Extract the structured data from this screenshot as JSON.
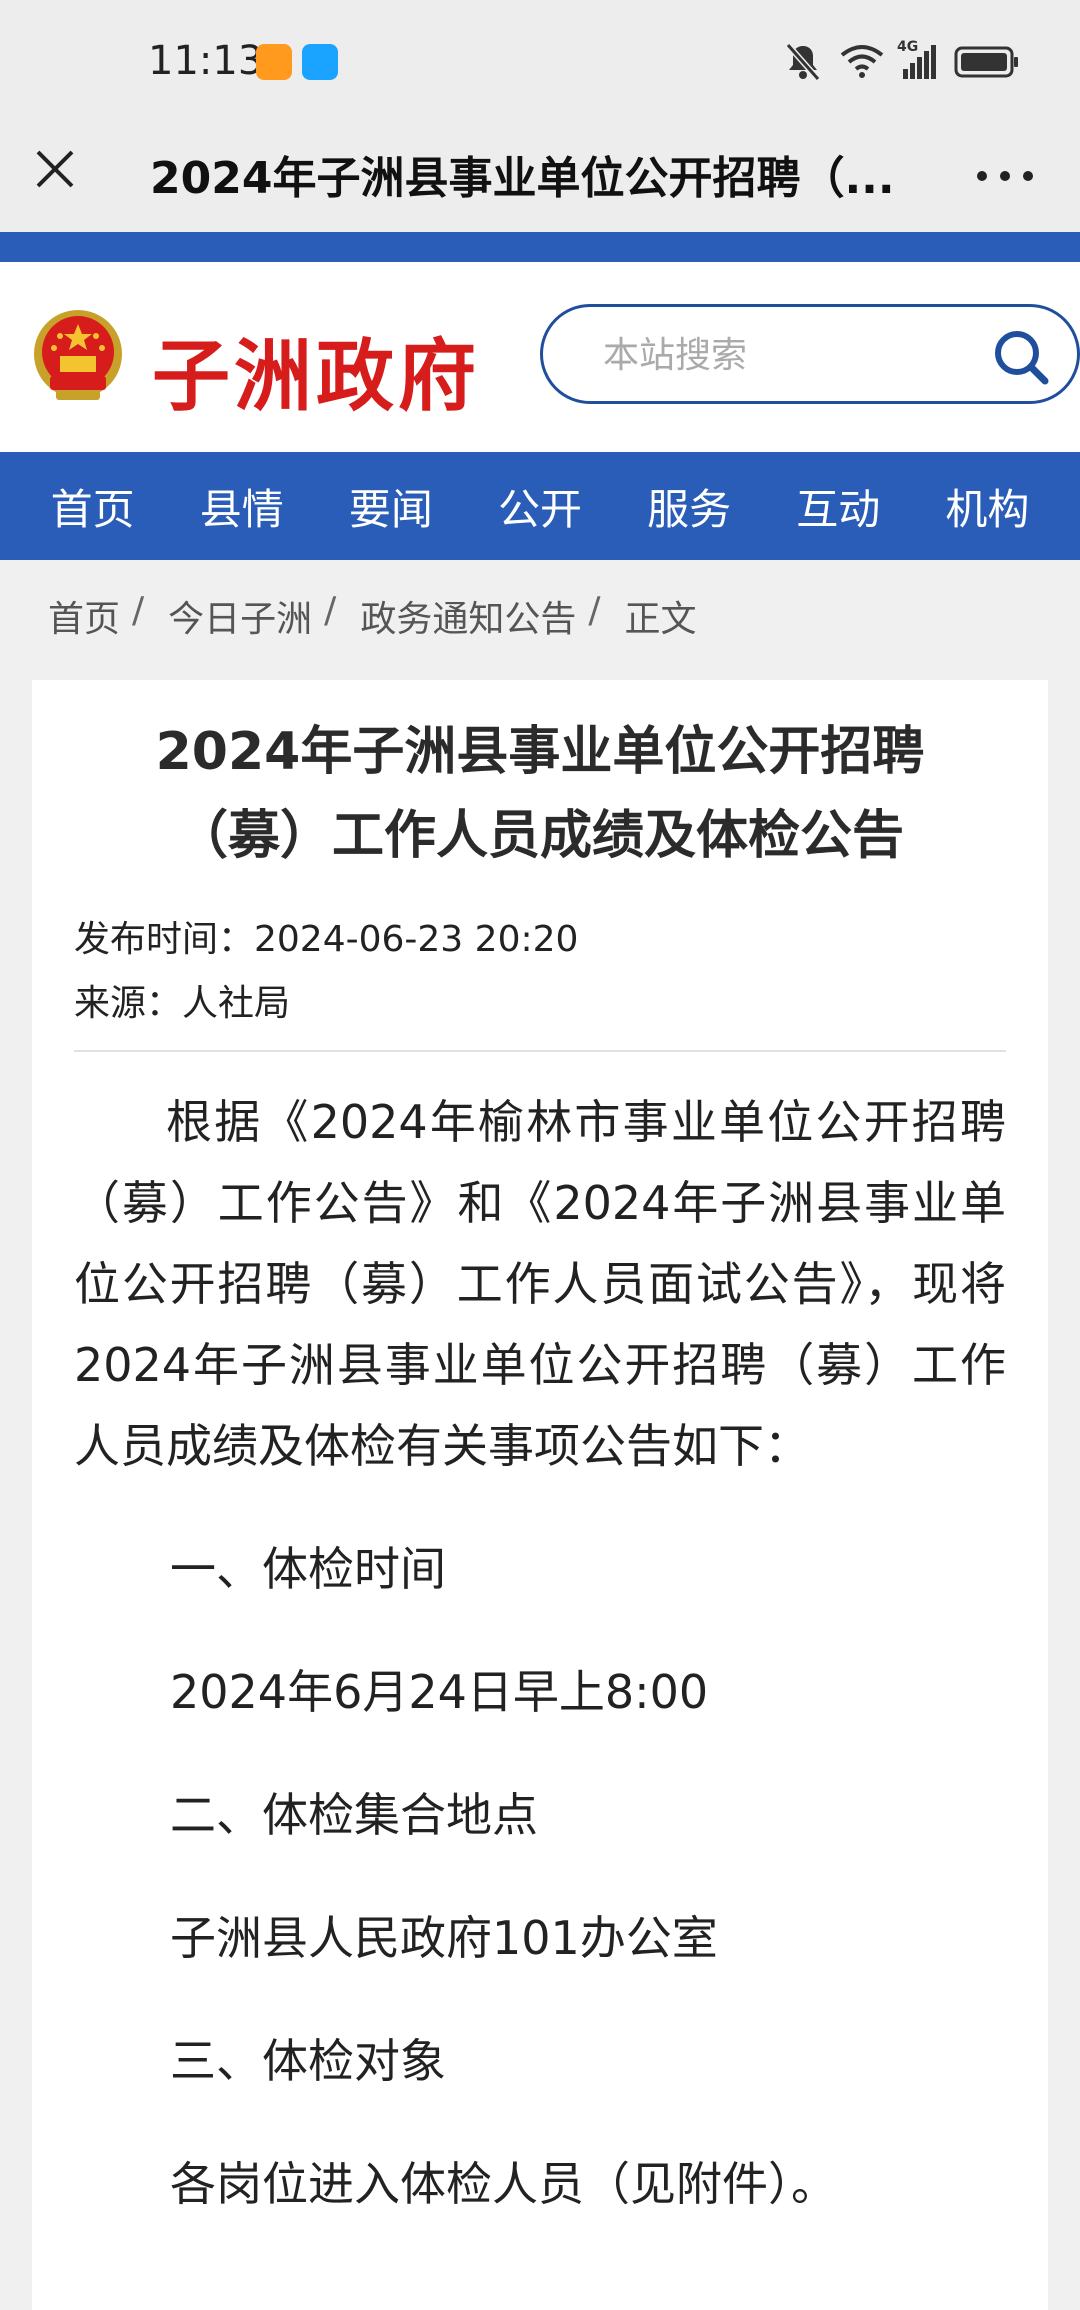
{
  "status_bar": {
    "time": "11:13",
    "network": "4G",
    "icons": [
      "app-icon-orange",
      "app-icon-blue",
      "mute-bell-icon",
      "wifi-icon",
      "signal-icon",
      "battery-icon"
    ]
  },
  "title_bar": {
    "title": "2024年子洲县事业单位公开招聘（..."
  },
  "header": {
    "site_name": "子洲政府",
    "search_placeholder": "本站搜索"
  },
  "nav": {
    "items": [
      "首页",
      "县情",
      "要闻",
      "公开",
      "服务",
      "互动",
      "机构"
    ]
  },
  "breadcrumb": {
    "items": [
      "首页",
      "今日子洲",
      "政务通知公告",
      "正文"
    ],
    "separator": "/"
  },
  "article": {
    "title_line1": "2024年子洲县事业单位公开招聘",
    "title_line2": "（募）工作人员成绩及体检公告",
    "publish_time": "发布时间：2024-06-23 20:20",
    "source": "来源：人社局",
    "intro": "根据《2024年榆林市事业单位公开招聘（募）工作公告》和《2024年子洲县事业单位公开招聘（募）工作人员面试公告》，现将2024年子洲县事业单位公开招聘（募）工作人员成绩及体检有关事项公告如下：",
    "section1_heading": "一、体检时间",
    "section1_value": "2024年6月24日早上8:00",
    "section2_heading": "二、体检集合地点",
    "section2_value": "子洲县人民政府101办公室",
    "section3_heading": "三、体检对象",
    "section3_value": "各岗位进入体检人员（见附件）。"
  },
  "colors": {
    "brand_blue": "#2a5db8",
    "site_name_red": "#d71c1c",
    "search_border": "#1f4f9c"
  }
}
